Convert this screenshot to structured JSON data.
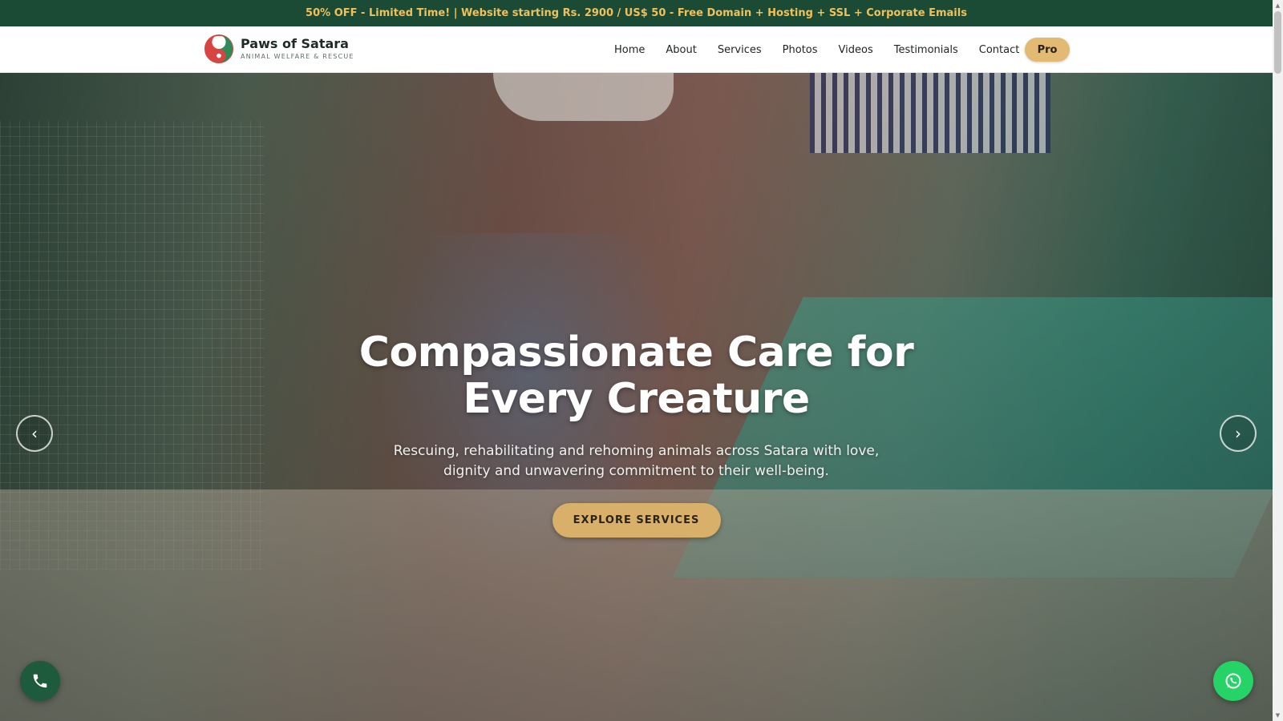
{
  "promo": {
    "text": "50% OFF - Limited Time! | Website starting Rs. 2900 / US$ 50 - Free Domain + Hosting + SSL + Corporate Emails"
  },
  "brand": {
    "title": "Paws of Satara",
    "subtitle": "ANIMAL WELFARE & RESCUE",
    "logo_icon": "paw-yin-yang-logo"
  },
  "nav": {
    "items": [
      {
        "label": "Home"
      },
      {
        "label": "About"
      },
      {
        "label": "Services"
      },
      {
        "label": "Photos"
      },
      {
        "label": "Videos"
      },
      {
        "label": "Testimonials"
      },
      {
        "label": "Contact"
      }
    ],
    "pro_label": "Pro"
  },
  "hero": {
    "title": "Compassionate Care for Every Creature",
    "subtitle": "Rescuing, rehabilitating and rehoming animals across Satara with love, dignity and unwavering commitment to their well-being.",
    "cta_label": "EXPLORE SERVICES",
    "prev_icon": "‹",
    "next_icon": "›"
  },
  "floating": {
    "phone_icon": "phone-icon",
    "whatsapp_icon": "whatsapp-icon"
  },
  "colors": {
    "promo_bg": "#1b4a35",
    "promo_text": "#f0c15a",
    "accent_gold": "#e2ba74",
    "whatsapp_green": "#25d366",
    "phone_green": "#1e5a3c"
  }
}
